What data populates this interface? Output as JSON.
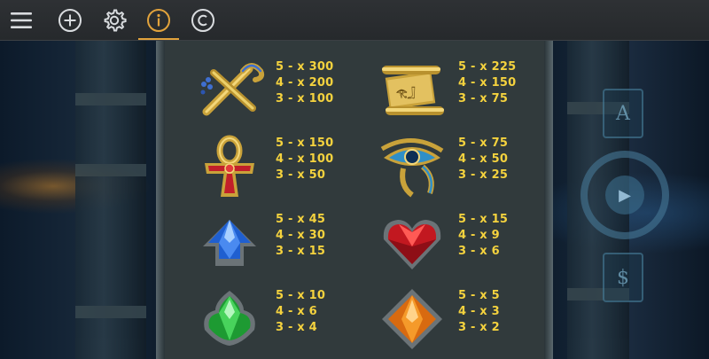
{
  "toolbar": {
    "buttons": [
      {
        "icon": "hamburger-menu-icon"
      },
      {
        "icon": "plus-icon"
      },
      {
        "icon": "gear-icon"
      },
      {
        "icon": "info-icon",
        "active": true
      },
      {
        "icon": "copyright-icon"
      }
    ],
    "active_color": "#e2a33c",
    "icon_color": "#d9dcdf"
  },
  "side_decor": {
    "card_a": "A",
    "card_dollar": "$"
  },
  "paytable": {
    "symbols": [
      {
        "name": "crook-and-flail",
        "pays": [
          "5 - x 300",
          "4 - x 200",
          "3 - x 100"
        ]
      },
      {
        "name": "papyrus-scroll",
        "pays": [
          "5 - x 225",
          "4 - x 150",
          "3 - x 75"
        ]
      },
      {
        "name": "ankh",
        "pays": [
          "5 - x 150",
          "4 - x 100",
          "3 - x 50"
        ]
      },
      {
        "name": "eye-of-horus",
        "pays": [
          "5 - x 75",
          "4 - x 50",
          "3 - x 25"
        ]
      },
      {
        "name": "blue-gem",
        "pays": [
          "5 - x 45",
          "4 - x 30",
          "3 - x 15"
        ]
      },
      {
        "name": "red-heart-gem",
        "pays": [
          "5 - x 15",
          "4 - x 9",
          "3 - x 6"
        ]
      },
      {
        "name": "green-gem",
        "pays": [
          "5 - x 10",
          "4 - x 6",
          "3 - x 4"
        ]
      },
      {
        "name": "orange-diamond-gem",
        "pays": [
          "5 - x 5",
          "4 - x 3",
          "3 - x 2"
        ]
      }
    ],
    "pay_color": "#f4d23e"
  }
}
